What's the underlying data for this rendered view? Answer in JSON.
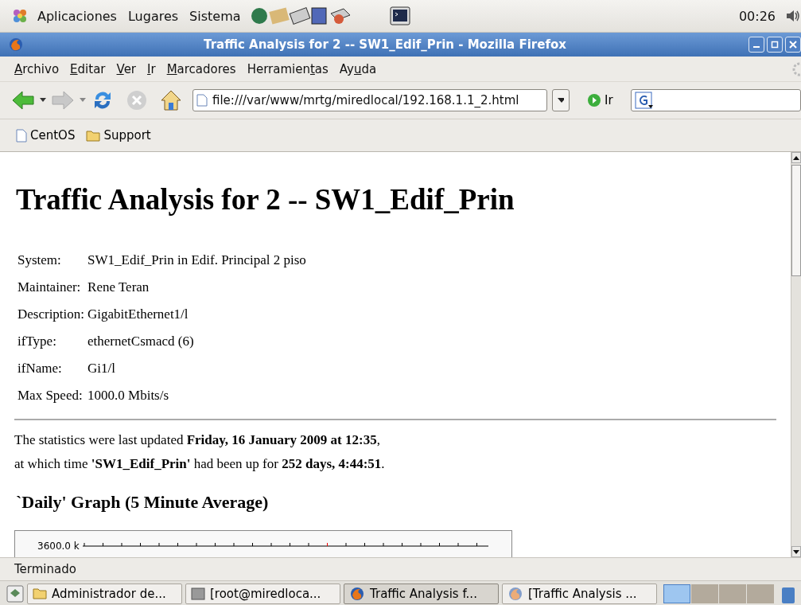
{
  "top_panel": {
    "menus": [
      "Aplicaciones",
      "Lugares",
      "Sistema"
    ],
    "clock": "00:26"
  },
  "window": {
    "title": "Traffic Analysis for 2 -- SW1_Edif_Prin - Mozilla Firefox"
  },
  "menu_bar": [
    {
      "key": "A",
      "post": "rchivo"
    },
    {
      "key": "E",
      "post": "ditar"
    },
    {
      "key": "V",
      "post": "er"
    },
    {
      "key": "I",
      "post": "r"
    },
    {
      "key": "M",
      "post": "arcadores"
    },
    {
      "pre": "Herramien",
      "key": "t",
      "post": "as"
    },
    {
      "pre": "Ay",
      "key": "u",
      "post": "da"
    }
  ],
  "nav": {
    "url": "file:///var/www/mrtg/miredlocal/192.168.1.1_2.html",
    "go": "Ir",
    "back_disabled": false,
    "forward_disabled": true,
    "stop_disabled": true
  },
  "bookmarks": [
    {
      "kind": "page",
      "label": "CentOS"
    },
    {
      "kind": "folder",
      "label": "Support"
    }
  ],
  "page": {
    "heading": "Traffic Analysis for 2 -- SW1_Edif_Prin",
    "info": [
      {
        "label": "System:",
        "value": "SW1_Edif_Prin in Edif. Principal 2 piso"
      },
      {
        "label": "Maintainer:",
        "value": "Rene Teran"
      },
      {
        "label": "Description:",
        "value": "GigabitEthernet1/l"
      },
      {
        "label": "ifType:",
        "value": "ethernetCsmacd (6)"
      },
      {
        "label": "ifName:",
        "value": "Gi1/l"
      },
      {
        "label": "Max Speed:",
        "value": "1000.0 Mbits/s"
      }
    ],
    "updated_lines": [
      "The statistics were last updated **Friday, 16 January 2009 at 12:35**,",
      "at which time **'SW1_Edif_Prin'** had been up for **252 days, 4:44:51**."
    ],
    "graph_heading": "`Daily' Graph (5 Minute Average)",
    "graph_top_label": "3600.0 k"
  },
  "status_bar": "Terminado",
  "taskbar": {
    "tasks": [
      {
        "kind": "folder",
        "label": "Administrador de...",
        "selected": false
      },
      {
        "kind": "terminal",
        "label": "[root@miredloca...",
        "selected": false
      },
      {
        "kind": "browser",
        "label": "Traffic Analysis f...",
        "selected": true
      },
      {
        "kind": "browser-faded",
        "label": "[Traffic Analysis ...",
        "selected": false
      }
    ],
    "workspaces": [
      {
        "selected": true
      },
      {
        "selected": false
      },
      {
        "selected": false
      },
      {
        "selected": false
      }
    ]
  }
}
